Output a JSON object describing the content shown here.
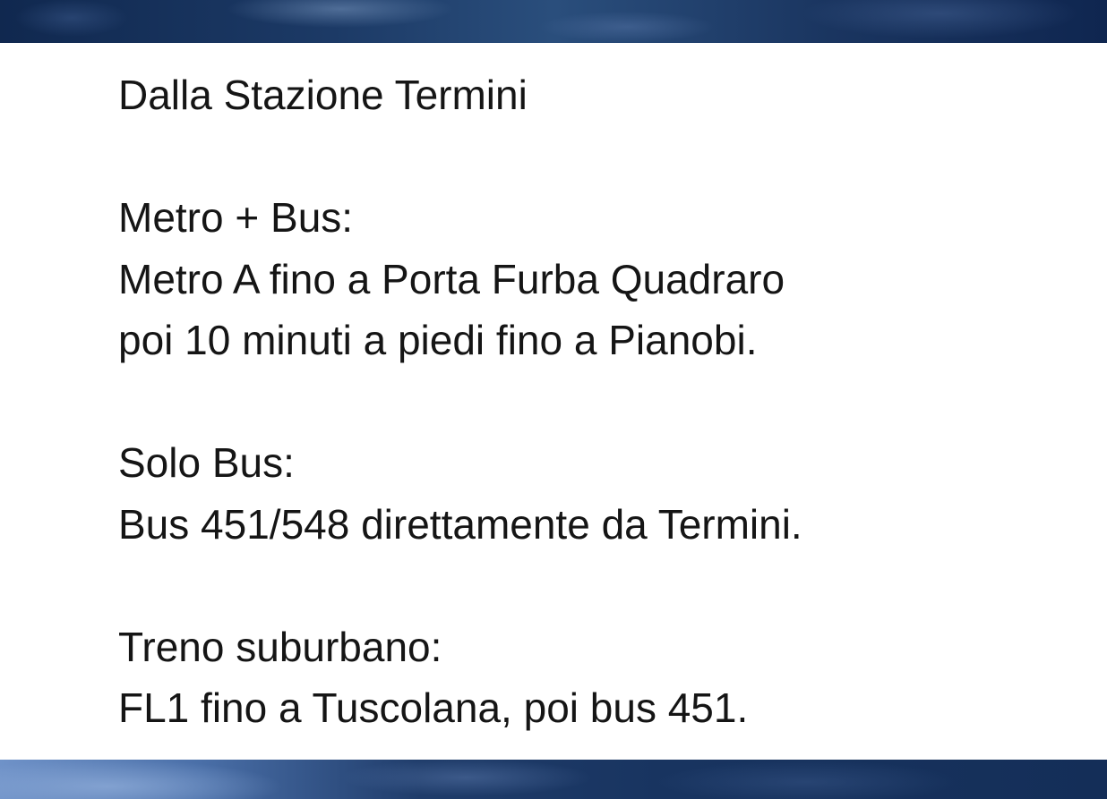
{
  "heading": "Dalla Stazione Termini",
  "sections": [
    {
      "title": "Metro + Bus:",
      "lines": [
        "Metro A fino a Porta Furba Quadraro",
        "poi 10 minuti a piedi fino a Pianobi."
      ]
    },
    {
      "title": "Solo Bus:",
      "lines": [
        "Bus 451/548 direttamente da Termini."
      ]
    },
    {
      "title": "Treno suburbano:",
      "lines": [
        "FL1 fino a Tuscolana, poi bus 451."
      ]
    }
  ]
}
